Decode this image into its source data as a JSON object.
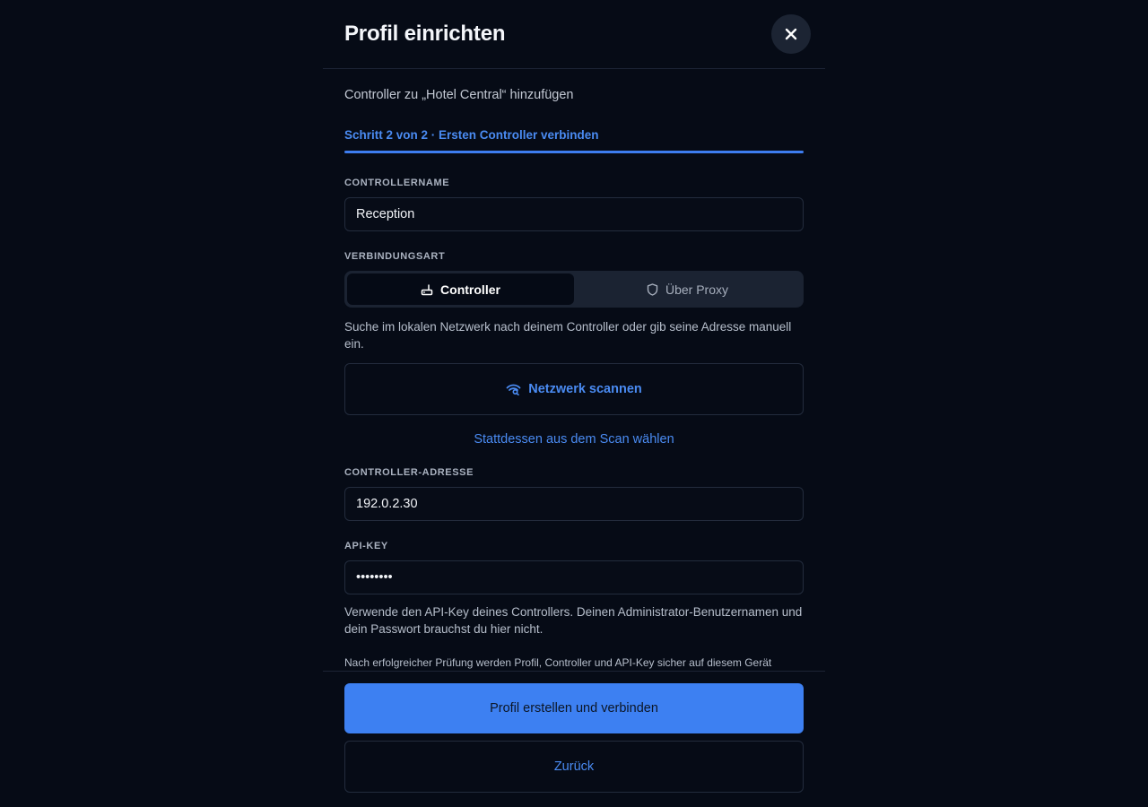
{
  "dialog": {
    "title": "Profil einrichten",
    "close_icon": "close-icon",
    "subtitle": "Controller zu „Hotel Central“ hinzufügen",
    "step_text": "Schritt 2 von 2 · Ersten Controller verbinden",
    "progress_fraction": 1.0
  },
  "form": {
    "controller_name": {
      "label": "CONTROLLERNAME",
      "value": "Reception"
    },
    "connection_type": {
      "label": "VERBINDUNGSART",
      "options": [
        {
          "label": "Controller",
          "icon": "router-icon",
          "selected": true
        },
        {
          "label": "Über Proxy",
          "icon": "shield-icon",
          "selected": false
        }
      ]
    },
    "connection_help": "Suche im lokalen Netzwerk nach deinem Controller oder gib seine Adresse manuell ein.",
    "scan_button": {
      "label": "Netzwerk scannen",
      "icon": "wifi-scan-icon"
    },
    "choose_from_scan_link": "Stattdessen aus dem Scan wählen",
    "controller_address": {
      "label": "CONTROLLER-ADRESSE",
      "value": "192.0.2.30"
    },
    "api_key": {
      "label": "API-KEY",
      "value": "••••••••"
    },
    "api_key_help": "Verwende den API-Key deines Controllers. Deinen Administrator-Benutzernamen und dein Passwort brauchst du hier nicht.",
    "storage_note": "Nach erfolgreicher Prüfung werden Profil, Controller und API-Key sicher auf diesem Gerät"
  },
  "footer": {
    "primary_label": "Profil erstellen und verbinden",
    "secondary_label": "Zurück"
  },
  "colors": {
    "background": "#060b16",
    "accent": "#3d80f2",
    "link": "#4a8bf2",
    "field_border": "#232c3d"
  }
}
